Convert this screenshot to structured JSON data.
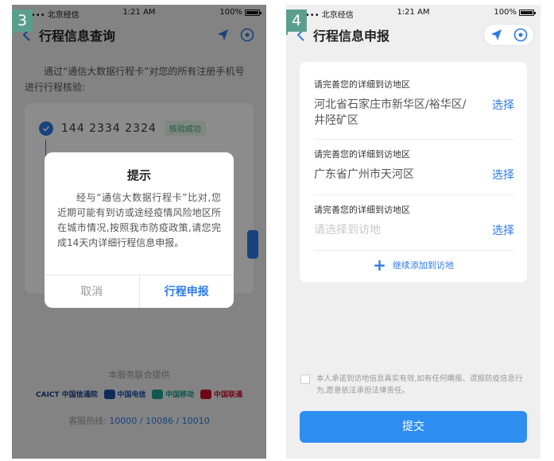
{
  "screens": {
    "s3": {
      "step": "3",
      "status": {
        "carrier": "•••• 北京经信",
        "time": "1:21 AM",
        "battery": "100%"
      },
      "nav": {
        "title": "行程信息查询"
      },
      "intro": "通过“通信大数据行程卡”对您的所有注册手机号进行行程核验:",
      "phone": "144 2334 2324",
      "verify": "核验成功",
      "provider": "本服务联合提供",
      "logos": [
        "CAICT 中国信通院",
        "中国电信",
        "中国移动",
        "中国联通"
      ],
      "hotline_label": "客服热线:",
      "hotline_nums": "10000 / 10086 / 10010",
      "dialog": {
        "title": "提示",
        "body": "经与“通信大数据行程卡”比对,您近期可能有到访或途经疫情风险地区所在城市情况,按照我市防疫政策,请您完成14天内详细行程信息申报。",
        "cancel": "取消",
        "confirm": "行程申报"
      }
    },
    "s4": {
      "step": "4",
      "status": {
        "carrier": "•••• 北京经信",
        "time": "1:21 AM",
        "battery": "100%"
      },
      "nav": {
        "title": "行程信息申报"
      },
      "fields": [
        {
          "label": "请完善您的详细到访地区",
          "value": "河北省石家庄市新华区/裕华区/井陉矿区",
          "pick": "选择"
        },
        {
          "label": "请完善您的详细到访地区",
          "value": "广东省广州市天河区",
          "pick": "选择"
        },
        {
          "label": "请完善您的详细到访地区",
          "placeholder": "请选择到访地",
          "pick": "选择"
        }
      ],
      "add_more": "继续添加到访地",
      "agreement": "本人承诺到访地信息真实有效,如有任何瞒报、谎报防疫信息行为,愿意依法承担法律责任。",
      "submit": "提交"
    }
  },
  "colors": {
    "accent": "#2d7be6",
    "step_tag": "#5a9f8e",
    "success": "#3aa66a"
  }
}
